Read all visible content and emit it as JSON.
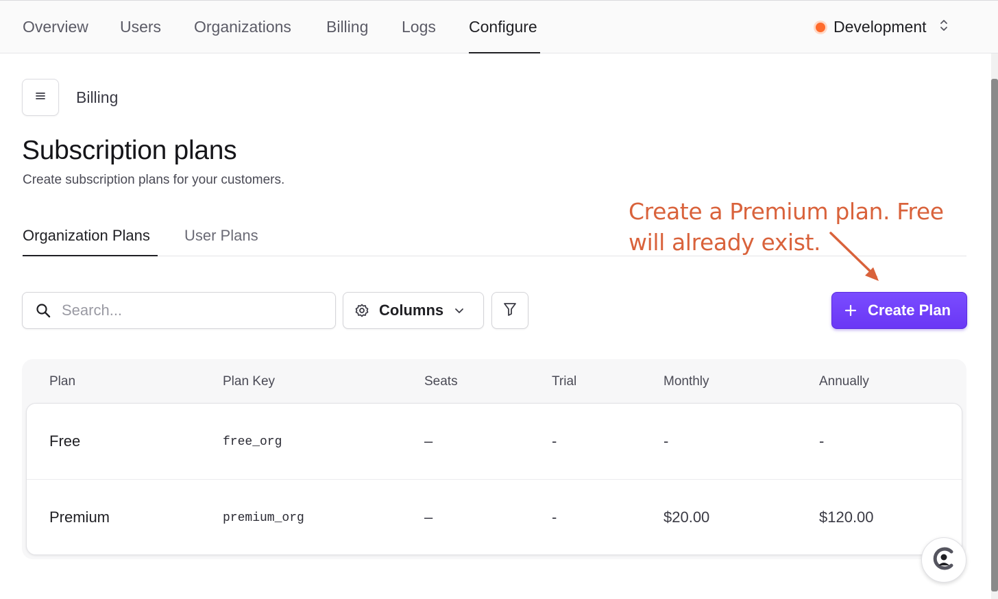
{
  "nav": {
    "items": [
      {
        "label": "Overview"
      },
      {
        "label": "Users"
      },
      {
        "label": "Organizations"
      },
      {
        "label": "Billing"
      },
      {
        "label": "Logs"
      },
      {
        "label": "Configure",
        "active": true
      }
    ],
    "environment": "Development",
    "environment_color": "#ff6b2c"
  },
  "header": {
    "breadcrumb": "Billing",
    "title": "Subscription plans",
    "subtitle": "Create subscription plans for your customers."
  },
  "tabs": [
    {
      "label": "Organization Plans",
      "active": true
    },
    {
      "label": "User Plans",
      "active": false
    }
  ],
  "annotation": {
    "text": "Create a Premium plan. Free will already exist.",
    "color": "#d9623b"
  },
  "toolbar": {
    "search_placeholder": "Search...",
    "columns_label": "Columns",
    "create_label": "Create Plan",
    "accent": "#6a37f5"
  },
  "table": {
    "columns": [
      "Plan",
      "Plan Key",
      "Seats",
      "Trial",
      "Monthly",
      "Annually"
    ],
    "rows": [
      {
        "plan": "Free",
        "key": "free_org",
        "seats": "–",
        "trial": "-",
        "monthly": "-",
        "annually": "-"
      },
      {
        "plan": "Premium",
        "key": "premium_org",
        "seats": "–",
        "trial": "-",
        "monthly": "$20.00",
        "annually": "$120.00"
      }
    ]
  },
  "icons": {
    "menu": "hamburger-icon",
    "search": "search-icon",
    "columns": "gear-icon",
    "filter": "filter-icon",
    "create": "plus-icon",
    "env": "chevron-up-down-icon",
    "support": "support-logo-icon"
  }
}
